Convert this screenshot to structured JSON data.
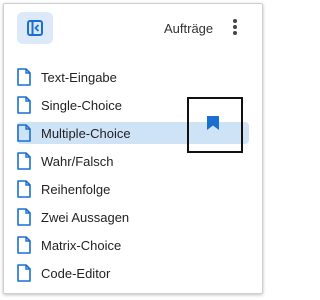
{
  "header": {
    "title": "Aufträge"
  },
  "colors": {
    "accent": "#1a6fd1",
    "selected_bg": "#cfe3f7",
    "toggle_bg": "#dce9f8"
  },
  "icons": {
    "toggle": "sidebar-toggle-icon",
    "more": "more-vertical-icon",
    "document": "document-icon",
    "bookmark": "bookmark-icon"
  },
  "items": [
    {
      "label": "Text-Eingabe",
      "selected": false
    },
    {
      "label": "Single-Choice",
      "selected": false
    },
    {
      "label": "Multiple-Choice",
      "selected": true
    },
    {
      "label": "Wahr/Falsch",
      "selected": false
    },
    {
      "label": "Reihenfolge",
      "selected": false
    },
    {
      "label": "Zwei Aussagen",
      "selected": false
    },
    {
      "label": "Matrix-Choice",
      "selected": false
    },
    {
      "label": "Code-Editor",
      "selected": false
    }
  ]
}
